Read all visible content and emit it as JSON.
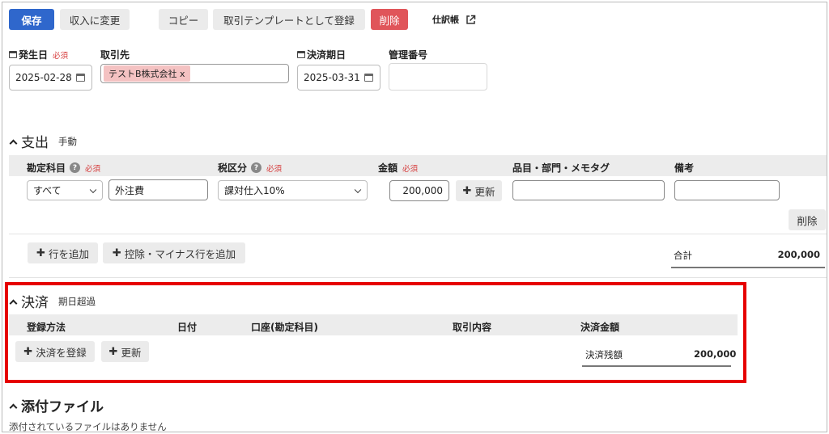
{
  "toolbar": {
    "save": "保存",
    "to_income": "収入に変更",
    "copy": "コピー",
    "register_template": "取引テンプレートとして登録",
    "delete": "削除",
    "journal": "仕訳帳"
  },
  "header_fields": {
    "issue_date_label": "発生日",
    "required": "必須",
    "issue_date_value": "2025-02-28",
    "partner_label": "取引先",
    "partner_tag": "テストB株式会社 x",
    "due_date_label": "決済期日",
    "due_date_value": "2025-03-31",
    "control_number_label": "管理番号"
  },
  "expense": {
    "title": "支出",
    "mode": "手動",
    "columns": {
      "account": "勘定科目",
      "tax": "税区分",
      "amount": "金額",
      "item": "品目・部門・メモタグ",
      "note": "備考"
    },
    "row": {
      "account_filter": "すべて",
      "account_value": "外注費",
      "tax_value": "課対仕入10%",
      "amount_value": "200,000",
      "update": "更新",
      "delete": "削除"
    },
    "add_row": "行を追加",
    "add_deduction_row": "控除・マイナス行を追加",
    "total_label": "合計",
    "total_value": "200,000"
  },
  "settlement": {
    "title": "決済",
    "status": "期日超過",
    "columns": {
      "method": "登録方法",
      "date": "日付",
      "account": "口座(勘定科目)",
      "content": "取引内容",
      "amount": "決済金額"
    },
    "register": "決済を登録",
    "update": "更新",
    "remaining_label": "決済残額",
    "remaining_value": "200,000"
  },
  "attachments": {
    "title": "添付ファイル",
    "empty_message": "添付されているファイルはありません"
  },
  "colors": {
    "primary": "#2f67cc",
    "danger": "#e0555a",
    "highlight_border": "#e60000",
    "tag_bg": "#f4c2c2"
  }
}
